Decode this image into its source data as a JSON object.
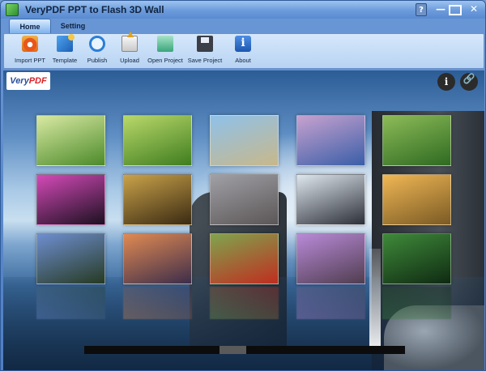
{
  "window": {
    "title": "VeryPDF PPT to Flash 3D Wall"
  },
  "title_buttons": {
    "help": "?",
    "minimize": "—",
    "close": "✕"
  },
  "tabs": [
    {
      "label": "Home"
    },
    {
      "label": "Setting"
    }
  ],
  "toolbar": {
    "buttons": [
      {
        "label": "Import PPT",
        "icon": "import-ppt-icon"
      },
      {
        "label": "Template",
        "icon": "template-icon"
      },
      {
        "label": "Publish",
        "icon": "publish-icon"
      },
      {
        "label": "Upload",
        "icon": "upload-icon"
      },
      {
        "label": "Open Project",
        "icon": "open-project-icon"
      },
      {
        "label": "Save Project",
        "icon": "save-project-icon"
      },
      {
        "label": "About",
        "icon": "about-icon"
      }
    ]
  },
  "stage": {
    "logo_very": "Very",
    "logo_pdf": "PDF",
    "info_glyph": "i",
    "link_glyph": "🔗",
    "photo_tiles": [
      {
        "subject": "lone tree on green hill",
        "colors": [
          "#d8e9a2",
          "#4c8a2a"
        ]
      },
      {
        "subject": "rolling green fields",
        "colors": [
          "#b9d86a",
          "#3f7d1f"
        ]
      },
      {
        "subject": "frosted tree in meadow",
        "colors": [
          "#8fc1ea",
          "#c8b88a"
        ]
      },
      {
        "subject": "salt flats at dusk",
        "colors": [
          "#c7a2cf",
          "#3a5ea8"
        ]
      },
      {
        "subject": "tea plantation with red umbrella",
        "colors": [
          "#8dbb58",
          "#2e6a21"
        ]
      },
      {
        "subject": "colorful slot canyon",
        "colors": [
          "#d44ab8",
          "#1b1020"
        ]
      },
      {
        "subject": "golden forest path",
        "colors": [
          "#c9a24a",
          "#3a2a12"
        ]
      },
      {
        "subject": "campfire in misty valley",
        "colors": [
          "#a0a0a6",
          "#5b5656"
        ]
      },
      {
        "subject": "terraced fields in water",
        "colors": [
          "#dfe7ee",
          "#2c2f38"
        ]
      },
      {
        "subject": "hot air balloons over temples",
        "colors": [
          "#f0b755",
          "#7a5a24"
        ]
      },
      {
        "subject": "bluebell forest",
        "colors": [
          "#6e8ed0",
          "#263a22"
        ]
      },
      {
        "subject": "sunset over cloud sea",
        "colors": [
          "#e08a52",
          "#3d2d4a"
        ]
      },
      {
        "subject": "red poppies in vineyard",
        "colors": [
          "#7fa54e",
          "#c02d1f"
        ]
      },
      {
        "subject": "wisteria tunnel",
        "colors": [
          "#b98ad8",
          "#4f3d4f"
        ]
      },
      {
        "subject": "mossy forest stream",
        "colors": [
          "#3f8a3a",
          "#0f2a12"
        ]
      }
    ]
  },
  "scroll": {
    "position": 0.46
  }
}
